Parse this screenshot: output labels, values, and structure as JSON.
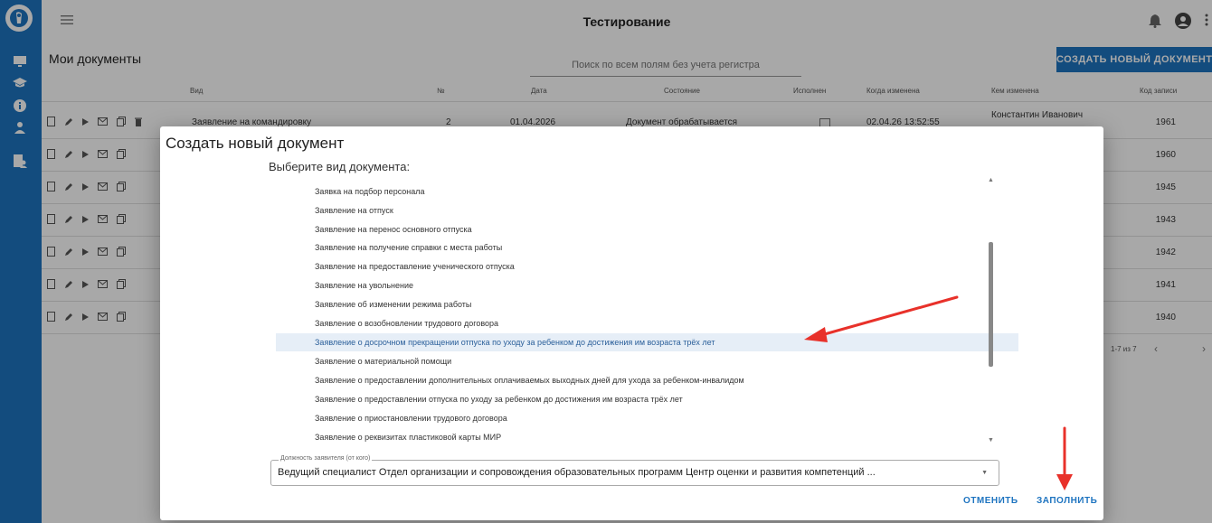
{
  "app": {
    "title": "Тестирование",
    "icons": [
      "hamburger-menu-icon",
      "bell-icon",
      "account-icon",
      "kebab-menu-icon"
    ]
  },
  "sidebar": {
    "icons": [
      "logo-icon",
      "monitor-icon",
      "graduation-cap-icon",
      "info-icon",
      "person-icon",
      "document-person-icon"
    ],
    "accent_color": "#1e74c0"
  },
  "page": {
    "title": "Мои документы",
    "search_placeholder": "Поиск по всем полям без учета регистра",
    "create_button": "СОЗДАТЬ НОВЫЙ ДОКУМЕНТ"
  },
  "table": {
    "columns": [
      "Вид",
      "№",
      "Дата",
      "Состояние",
      "Исполнен",
      "Когда изменена",
      "Кем изменена",
      "Код записи"
    ],
    "first_row": {
      "type": "Заявление на командировку",
      "number": "2",
      "date": "01.04.2026",
      "status": "Документ обрабатывается",
      "changed_at": "02.04.26 13:52:55",
      "changed_by": "Константин Иванович",
      "code": "1961"
    },
    "codes": [
      "1960",
      "1945",
      "1943",
      "1942",
      "1941",
      "1940"
    ],
    "pagination": "1-7 из 7"
  },
  "modal": {
    "title": "Создать новый документ",
    "subtitle": "Выберите вид документа:",
    "items": [
      "Заявка на подбор персонала",
      "Заявление на отпуск",
      "Заявление на перенос основного отпуска",
      "Заявление на получение справки с места работы",
      "Заявление на предоставление ученического отпуска",
      "Заявление на увольнение",
      "Заявление об изменении режима работы",
      "Заявление о возобновлении трудового договора",
      "Заявление о досрочном прекращении отпуска по уходу за ребенком до достижения им возраста трёх лет",
      "Заявление о материальной помощи",
      "Заявление о предоставлении дополнительных оплачиваемых выходных дней для ухода за ребенком-инвалидом",
      "Заявление о предоставлении отпуска по уходу за ребенком до достижения им возраста трёх лет",
      "Заявление о приостановлении трудового договора",
      "Заявление о реквизитах пластиковой карты МИР"
    ],
    "selected_index": 8,
    "position_field": {
      "label": "Должность заявителя (от кого)",
      "value": "Ведущий специалист Отдел организации и сопровождения образовательных программ Центр оценки и развития компетенций ..."
    },
    "cancel_button": "ОТМЕНИТЬ",
    "fill_button": "ЗАПОЛНИТЬ"
  },
  "annotations": {
    "arrow_color": "#e8312a"
  }
}
